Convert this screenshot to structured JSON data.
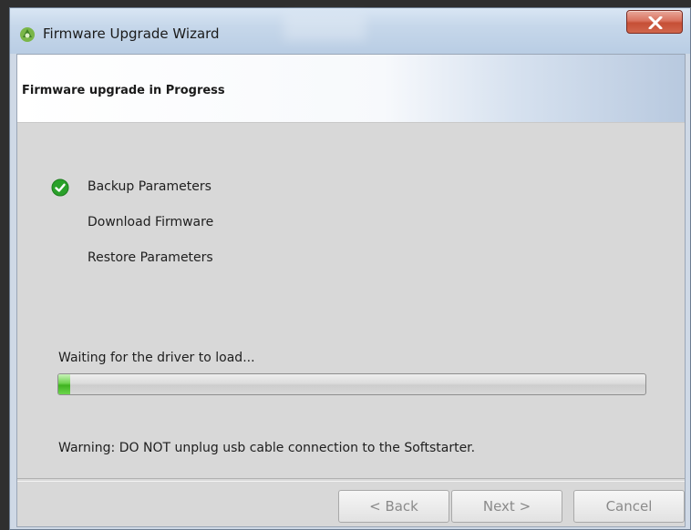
{
  "window": {
    "title": "Firmware Upgrade Wizard",
    "close_label": "X"
  },
  "header": {
    "title": "Firmware upgrade in Progress"
  },
  "steps": [
    {
      "label": "Backup Parameters",
      "done": true
    },
    {
      "label": "Download Firmware",
      "done": false
    },
    {
      "label": "Restore Parameters",
      "done": false
    }
  ],
  "status": {
    "message": "Waiting for the driver to load...",
    "progress": 0.02
  },
  "warning": "Warning: DO NOT unplug usb cable connection to the Softstarter.",
  "footer": {
    "back_label": "< Back",
    "next_label": "Next >",
    "cancel_label": "Cancel"
  },
  "colors": {
    "progress_fill": "#3fb320",
    "check": "#2aa12a",
    "close_button": "#c64f36"
  },
  "icons": {
    "app": "firmware-wizard-icon",
    "close": "close-icon",
    "done": "check-icon"
  }
}
